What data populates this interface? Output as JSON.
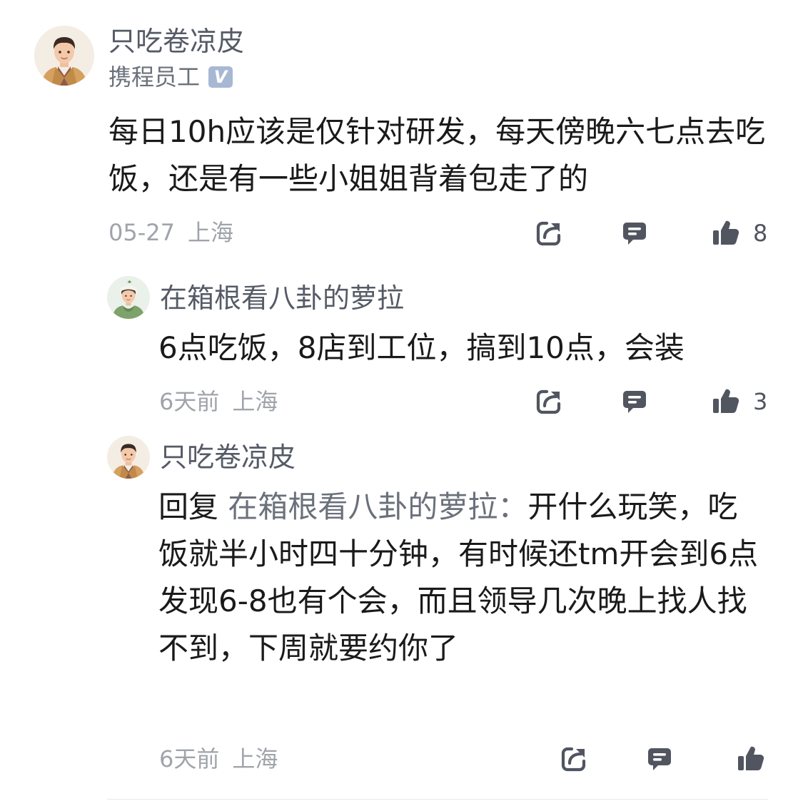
{
  "comments": [
    {
      "author": "只吃卷凉皮",
      "role": "携程员工",
      "verified_mark": "V",
      "text": "每日10h应该是仅针对研发，每天傍晚六七点去吃饭，还是有一些小姐姐背着包走了的",
      "date": "05-27",
      "location": "上海",
      "likes": "8"
    }
  ],
  "replies": [
    {
      "author": "在箱根看八卦的萝拉",
      "text": "6点吃饭，8店到工位，搞到10点，会装",
      "date": "6天前",
      "location": "上海",
      "likes": "3"
    },
    {
      "author": "只吃卷凉皮",
      "reply_prefix": "回复",
      "reply_to": "在箱根看八卦的萝拉：",
      "text": "开什么玩笑，吃饭就半小时四十分钟，有时候还tm开会到6点发现6-8也有个会，而且领导几次晚上找人找不到，下周就要约你了",
      "date": "6天前",
      "location": "上海",
      "likes": ""
    }
  ],
  "icons": {
    "share": "share-icon",
    "comment": "comment-icon",
    "like": "thumbs-up-icon"
  },
  "colors": {
    "author": "#555b66",
    "meta": "#a0a4aa",
    "text": "#1a1a1a",
    "icon": "#505560",
    "verified": "#a7b8d3"
  }
}
